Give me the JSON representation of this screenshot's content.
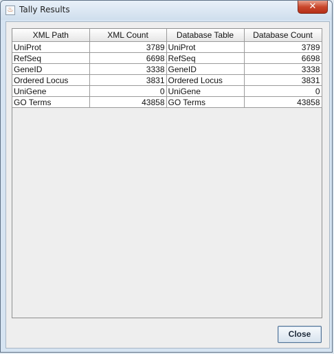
{
  "window": {
    "title": "Tally Results",
    "close_glyph": "✕"
  },
  "app_icon": {
    "name": "java-icon",
    "glyph": "♨"
  },
  "table": {
    "columns": [
      "XML Path",
      "XML Count",
      "Database Table",
      "Database Count"
    ],
    "rows": [
      {
        "xml_path": "UniProt",
        "xml_count": "3789",
        "db_table": "UniProt",
        "db_count": "3789"
      },
      {
        "xml_path": "RefSeq",
        "xml_count": "6698",
        "db_table": "RefSeq",
        "db_count": "6698"
      },
      {
        "xml_path": "GeneID",
        "xml_count": "3338",
        "db_table": "GeneID",
        "db_count": "3338"
      },
      {
        "xml_path": "Ordered Locus",
        "xml_count": "3831",
        "db_table": "Ordered Locus",
        "db_count": "3831"
      },
      {
        "xml_path": "UniGene",
        "xml_count": "0",
        "db_table": "UniGene",
        "db_count": "0"
      },
      {
        "xml_path": "GO Terms",
        "xml_count": "43858",
        "db_table": "GO Terms",
        "db_count": "43858"
      }
    ]
  },
  "buttons": {
    "close_label": "Close"
  },
  "colors": {
    "title_close_red": "#c9472c",
    "header_gradient_top": "#ffffff",
    "grid_line": "#9a9a9a"
  }
}
